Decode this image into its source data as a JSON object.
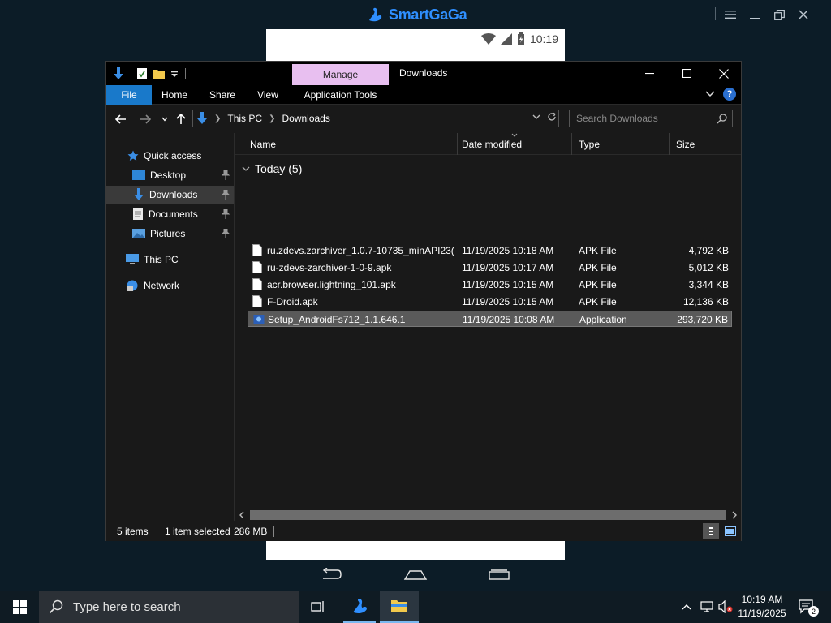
{
  "emulator": {
    "brand": "SmartGaGa",
    "phone_time": "10:19"
  },
  "explorer": {
    "title": "Downloads",
    "manage_tab": "Manage",
    "ribbon_tabs": [
      "File",
      "Home",
      "Share",
      "View",
      "Application Tools"
    ],
    "breadcrumb": [
      "This PC",
      "Downloads"
    ],
    "search_placeholder": "Search Downloads",
    "nav_pane": {
      "quick_access": "Quick access",
      "pinned": [
        "Desktop",
        "Downloads",
        "Documents",
        "Pictures"
      ],
      "this_pc": "This PC",
      "network": "Network",
      "selected": "Downloads"
    },
    "columns": [
      "Name",
      "Date modified",
      "Type",
      "Size"
    ],
    "group_label": "Today (5)",
    "files": [
      {
        "name": "ru.zdevs.zarchiver_1.0.7-10735_minAPI23(...",
        "date": "11/19/2025 10:18 AM",
        "type": "APK File",
        "size": "4,792 KB",
        "selected": false
      },
      {
        "name": "ru-zdevs-zarchiver-1-0-9.apk",
        "date": "11/19/2025 10:17 AM",
        "type": "APK File",
        "size": "5,012 KB",
        "selected": false
      },
      {
        "name": "acr.browser.lightning_101.apk",
        "date": "11/19/2025 10:15 AM",
        "type": "APK File",
        "size": "3,344 KB",
        "selected": false
      },
      {
        "name": "F-Droid.apk",
        "date": "11/19/2025 10:15 AM",
        "type": "APK File",
        "size": "12,136 KB",
        "selected": false
      },
      {
        "name": "Setup_AndroidFs712_1.1.646.1",
        "date": "11/19/2025 10:08 AM",
        "type": "Application",
        "size": "293,720 KB",
        "selected": true
      }
    ],
    "status": {
      "items": "5 items",
      "selection": "1 item selected",
      "selection_size": "286 MB"
    }
  },
  "taskbar": {
    "search_placeholder": "Type here to search",
    "time": "10:19 AM",
    "date": "11/19/2025",
    "notification_count": "2"
  },
  "colors": {
    "accent_blue": "#1979ca",
    "manage_tab": "#e8bff0",
    "selection": "#5a5a5a"
  }
}
